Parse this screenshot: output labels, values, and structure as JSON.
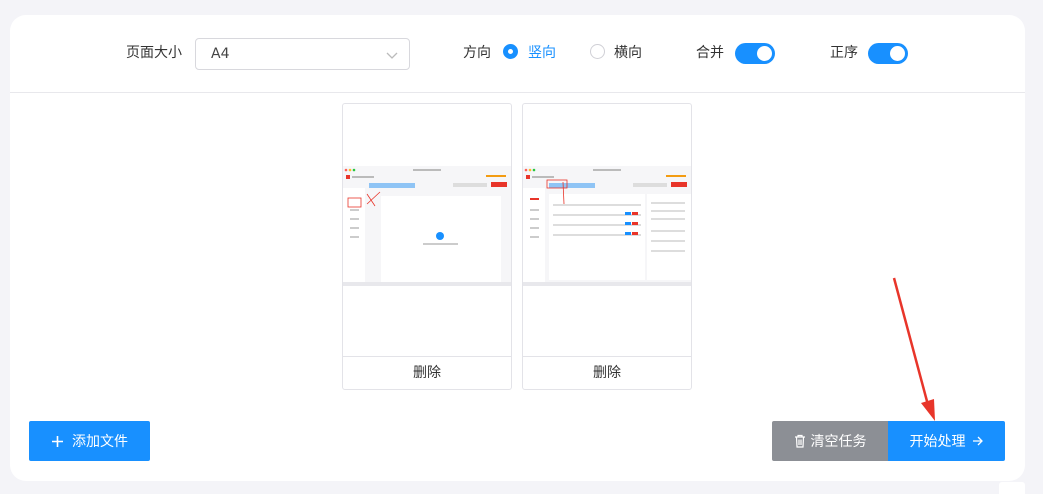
{
  "toolbar": {
    "page_size_label": "页面大小",
    "page_size_value": "A4",
    "orientation_label": "方向",
    "orientation_portrait": "竖向",
    "orientation_landscape": "横向",
    "merge_label": "合并",
    "order_label": "正序"
  },
  "cards": [
    {
      "delete_label": "删除"
    },
    {
      "delete_label": "删除"
    }
  ],
  "actions": {
    "add_file": "添加文件",
    "clear_tasks": "清空任务",
    "start_processing": "开始处理"
  },
  "colors": {
    "primary": "#1890ff",
    "gray_button": "#8c8f95",
    "annotation_arrow": "#e8352a"
  },
  "icons": {
    "add": "plus-icon",
    "clear": "trash-icon",
    "start": "arrow-right-icon",
    "select": "chevron-down-icon"
  }
}
